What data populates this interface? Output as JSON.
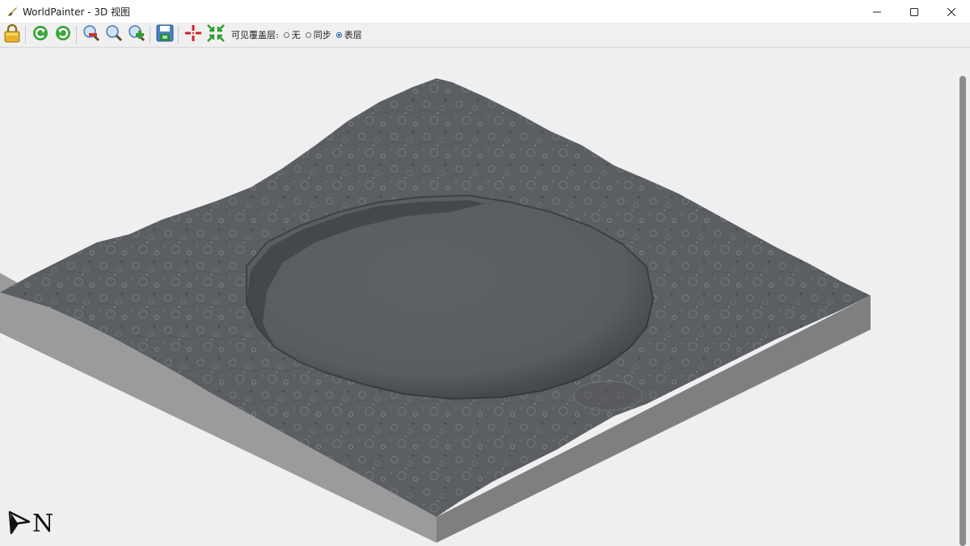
{
  "window": {
    "title": "WorldPainter - 3D 视图",
    "app_icon": "paintbrush-icon"
  },
  "controls": {
    "minimize_icon": "minimize-icon",
    "maximize_icon": "maximize-icon",
    "close_icon": "close-icon"
  },
  "toolbar": {
    "buttons": [
      {
        "name": "lock-button",
        "icon": "lock-icon"
      },
      {
        "name": "rotate-left-button",
        "icon": "rotate-left-icon"
      },
      {
        "name": "rotate-right-button",
        "icon": "rotate-right-icon"
      },
      {
        "name": "zoom-out-button",
        "icon": "zoom-out-icon"
      },
      {
        "name": "zoom-reset-button",
        "icon": "zoom-icon"
      },
      {
        "name": "zoom-in-button",
        "icon": "zoom-in-icon"
      },
      {
        "name": "save-image-button",
        "icon": "save-icon"
      },
      {
        "name": "center-view-button",
        "icon": "crosshair-icon"
      },
      {
        "name": "fit-view-button",
        "icon": "fit-arrows-icon"
      }
    ],
    "overlay_label": "可见覆盖层:",
    "overlay_options": [
      {
        "label": "无",
        "selected": false
      },
      {
        "label": "同步",
        "selected": false
      },
      {
        "label": "表层",
        "selected": true
      }
    ]
  },
  "compass": {
    "label": "N",
    "icon": "north-arrow-icon"
  },
  "colors": {
    "terrain": "#5a5d61",
    "terrain_side_left": "#9b9b9b",
    "terrain_side_right": "#7f7f7f",
    "radio_selected": "#1b5fb5"
  }
}
